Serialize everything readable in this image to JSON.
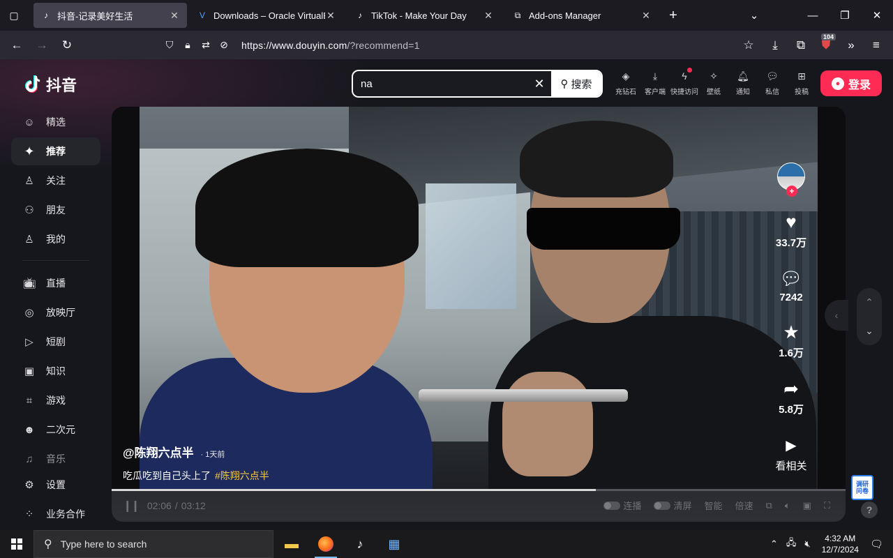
{
  "browser": {
    "tabs": [
      {
        "title": "抖音-记录美好生活",
        "active": true
      },
      {
        "title": "Downloads – Oracle VirtualBox",
        "active": false
      },
      {
        "title": "TikTok - Make Your Day",
        "active": false
      },
      {
        "title": "Add-ons Manager",
        "active": false
      }
    ],
    "url_host": "https://www.douyin.com",
    "url_rest": "/?recommend=1",
    "extension_badge": "104"
  },
  "douyin": {
    "logo_text": "抖音",
    "sidebar_top": [
      {
        "label": "精选",
        "icon": "featured-icon"
      },
      {
        "label": "推荐",
        "icon": "sparkle-icon",
        "active": true
      },
      {
        "label": "关注",
        "icon": "follow-icon"
      },
      {
        "label": "朋友",
        "icon": "friends-icon"
      },
      {
        "label": "我的",
        "icon": "profile-icon"
      }
    ],
    "sidebar_mid": [
      {
        "label": "直播",
        "icon": "live-tv-icon"
      },
      {
        "label": "放映厅",
        "icon": "cinema-icon"
      },
      {
        "label": "短剧",
        "icon": "short-drama-icon"
      },
      {
        "label": "知识",
        "icon": "knowledge-icon"
      },
      {
        "label": "游戏",
        "icon": "gamepad-icon"
      },
      {
        "label": "二次元",
        "icon": "anime-icon"
      },
      {
        "label": "音乐",
        "icon": "music-icon"
      }
    ],
    "sidebar_bottom": [
      {
        "label": "设置",
        "icon": "settings-icon"
      },
      {
        "label": "业务合作",
        "icon": "business-icon"
      }
    ],
    "search": {
      "value": "na",
      "button": "搜索"
    },
    "top_actions": [
      {
        "label": "充钻石",
        "icon": "diamond-icon"
      },
      {
        "label": "客户端",
        "icon": "download-client-icon"
      },
      {
        "label": "快捷访问",
        "icon": "quick-access-icon",
        "dot": true
      },
      {
        "label": "壁纸",
        "icon": "wallpaper-icon"
      },
      {
        "label": "通知",
        "icon": "bell-icon"
      },
      {
        "label": "私信",
        "icon": "message-icon"
      },
      {
        "label": "投稿",
        "icon": "upload-icon"
      }
    ],
    "login": "登录",
    "video": {
      "author": "@陈翔六点半",
      "posted": "· 1天前",
      "description": "吃瓜吃到自己头上了",
      "hashtag": "#陈翔六点半",
      "likes": "33.7万",
      "comments": "7242",
      "favorites": "1.6万",
      "shares": "5.8万",
      "related": "看相关",
      "time_current": "02:06",
      "time_total": "03:12",
      "progress": 0.66,
      "controls": {
        "autoplay": "连播",
        "clear_screen": "清屏",
        "smart": "智能",
        "speed": "倍速"
      }
    },
    "float_badge": "调研 问卷"
  },
  "taskbar": {
    "search_placeholder": "Type here to search",
    "time": "4:32 AM",
    "date": "12/7/2024"
  },
  "colors": {
    "accent": "#fe2c55",
    "hashtag": "#f5c94a",
    "browser_bg": "#1c1b22",
    "page_bg": "#16171d"
  }
}
